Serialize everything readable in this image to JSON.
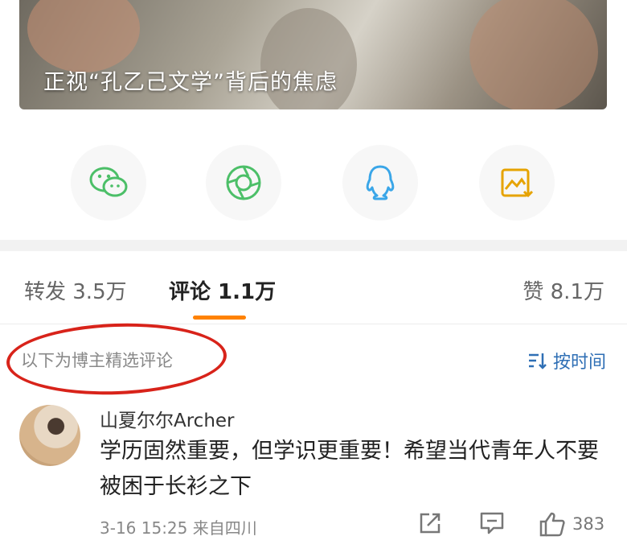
{
  "banner": {
    "caption": "正视“孔乙己文学”背后的焦虑"
  },
  "share": [
    {
      "icon": "wechat-icon",
      "color": "#4cbf68"
    },
    {
      "icon": "moments-icon",
      "color": "#4cbf68"
    },
    {
      "icon": "qq-icon",
      "color": "#3aa6e8"
    },
    {
      "icon": "save-image-icon",
      "color": "#e6a300"
    }
  ],
  "tabs": {
    "repost": "转发 3.5万",
    "comments": "评论 1.1万",
    "likes": "赞 8.1万"
  },
  "filter": {
    "label": "以下为博主精选评论",
    "sort": "按时间"
  },
  "comment": {
    "user": "山夏尔尔Archer",
    "text": "学历固然重要，但学识更重要！希望当代青年人不要被困于长衫之下",
    "time_source": "3-16 15:25 来自四川",
    "like_count": "383"
  },
  "colors": {
    "accent": "#ff8200",
    "link": "#2f6fb5",
    "annotation": "#d8231a"
  }
}
